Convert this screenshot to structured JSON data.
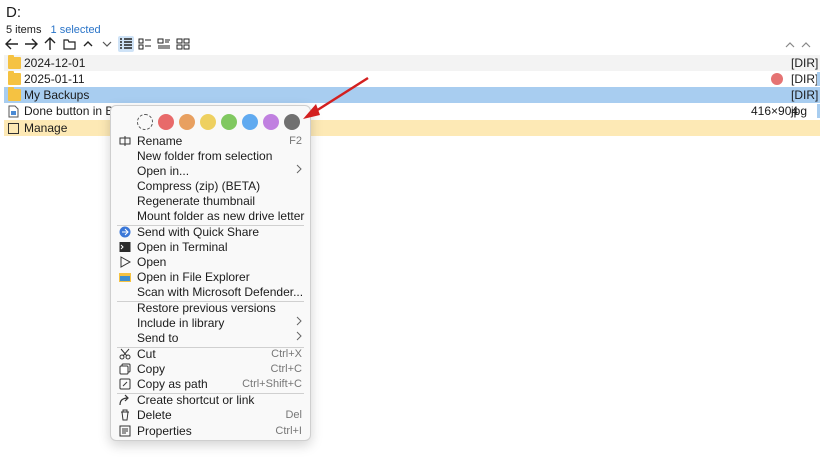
{
  "header": {
    "drive": "D:",
    "items_count": "5 items",
    "selected_count": "1 selected"
  },
  "files": [
    {
      "name": "2024-12-01",
      "type": "[DIR]",
      "dims": "",
      "kind": "folder",
      "tag": ""
    },
    {
      "name": "2025-01-11",
      "type": "[DIR]",
      "dims": "",
      "kind": "folder",
      "tag": "red"
    },
    {
      "name": "My Backups",
      "type": "[DIR]",
      "dims": "",
      "kind": "folder",
      "tag": ""
    },
    {
      "name": "Done button in Bluesk",
      "type": "jpg",
      "dims": "416×904",
      "kind": "image",
      "tag": ""
    },
    {
      "name": "Manage",
      "type": "",
      "dims": "",
      "kind": "manage",
      "tag": ""
    }
  ],
  "context_menu": {
    "colors": [
      "#ffffff",
      "#e86a6a",
      "#e8a060",
      "#eed060",
      "#80c860",
      "#60aaf0",
      "#c080e0",
      "#707070"
    ],
    "items": [
      {
        "label": "Rename",
        "shortcut": "F2",
        "icon": "rename-icon",
        "submenu": false
      },
      {
        "label": "New folder from selection",
        "shortcut": "",
        "icon": "",
        "submenu": false
      },
      {
        "label": "Open in...",
        "shortcut": "",
        "icon": "",
        "submenu": true
      },
      {
        "label": "Compress (zip) (BETA)",
        "shortcut": "",
        "icon": "",
        "submenu": false
      },
      {
        "label": "Regenerate thumbnail",
        "shortcut": "",
        "icon": "",
        "submenu": false
      },
      {
        "label": "Mount folder as new drive letter",
        "shortcut": "",
        "icon": "",
        "submenu": false
      },
      {
        "label": "Send with Quick Share",
        "shortcut": "",
        "icon": "quick-share-icon",
        "submenu": false
      },
      {
        "label": "Open in Terminal",
        "shortcut": "",
        "icon": "terminal-icon",
        "submenu": false
      },
      {
        "label": "Open",
        "shortcut": "",
        "icon": "play-icon",
        "submenu": false
      },
      {
        "label": "Open in File Explorer",
        "shortcut": "",
        "icon": "file-explorer-icon",
        "submenu": false
      },
      {
        "label": "Scan with Microsoft Defender...",
        "shortcut": "",
        "icon": "",
        "submenu": false
      },
      {
        "label": "Restore previous versions",
        "shortcut": "",
        "icon": "",
        "submenu": false
      },
      {
        "label": "Include in library",
        "shortcut": "",
        "icon": "",
        "submenu": true
      },
      {
        "label": "Send to",
        "shortcut": "",
        "icon": "",
        "submenu": true
      },
      {
        "label": "Cut",
        "shortcut": "Ctrl+X",
        "icon": "cut-icon",
        "submenu": false
      },
      {
        "label": "Copy",
        "shortcut": "Ctrl+C",
        "icon": "copy-icon",
        "submenu": false
      },
      {
        "label": "Copy as path",
        "shortcut": "Ctrl+Shift+C",
        "icon": "copy-path-icon",
        "submenu": false
      },
      {
        "label": "Create shortcut or link",
        "shortcut": "",
        "icon": "shortcut-icon",
        "submenu": false
      },
      {
        "label": "Delete",
        "shortcut": "Del",
        "icon": "delete-icon",
        "submenu": false
      },
      {
        "label": "Properties",
        "shortcut": "Ctrl+I",
        "icon": "properties-icon",
        "submenu": false
      }
    ]
  }
}
